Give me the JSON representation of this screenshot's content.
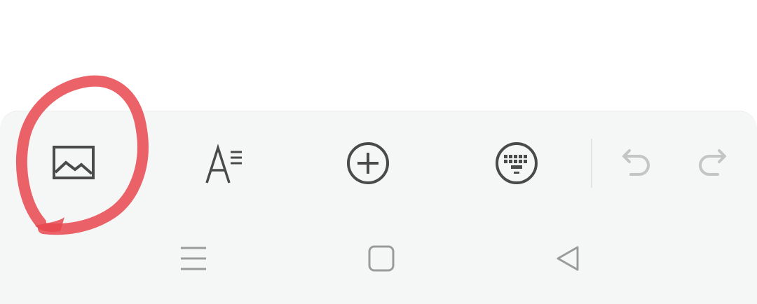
{
  "editor_toolbar": {
    "tools": [
      {
        "name": "insert-image",
        "icon": "image-icon",
        "enabled": true
      },
      {
        "name": "text-format",
        "icon": "text-format-icon",
        "enabled": true
      },
      {
        "name": "add",
        "icon": "add-circle-icon",
        "enabled": true
      },
      {
        "name": "keyboard",
        "icon": "keyboard-icon",
        "enabled": true
      },
      {
        "name": "undo",
        "icon": "undo-icon",
        "enabled": false
      },
      {
        "name": "redo",
        "icon": "redo-icon",
        "enabled": false
      }
    ]
  },
  "navigation_bar": {
    "buttons": [
      {
        "name": "recent-apps",
        "icon": "menu-lines-icon"
      },
      {
        "name": "home",
        "icon": "home-square-icon"
      },
      {
        "name": "back",
        "icon": "back-triangle-icon"
      }
    ]
  },
  "annotation": {
    "shape": "hand-drawn circle",
    "highlights": "insert-image",
    "color": "#e8484d"
  },
  "colors": {
    "panel_background": "#f5f6f6",
    "icon_active": "#4a4a4a",
    "icon_disabled": "#c4c6c6",
    "nav_icon": "#9a9c9c"
  }
}
